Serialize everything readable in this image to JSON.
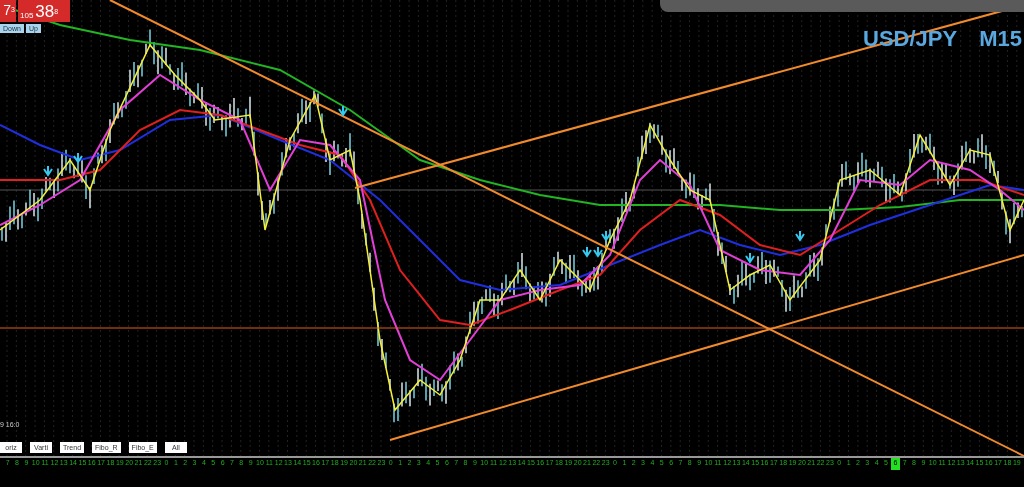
{
  "quote_panel": {
    "bid": {
      "main": "7",
      "sup": "3"
    },
    "ask": {
      "small": "105",
      "main": "38",
      "sup": "8"
    },
    "buttons": [
      "Down",
      "Up"
    ]
  },
  "symbol": "USD/JPY",
  "timeframe": "M15",
  "timestamp": "9 16:0",
  "tool_buttons": [
    "oriz",
    "Varti",
    "Trend",
    "Fibo_R",
    "Fibo_E",
    "All"
  ],
  "hour_labels": [
    {
      "label": "7",
      "selected": false
    },
    {
      "label": "8",
      "selected": false
    },
    {
      "label": "9",
      "selected": false
    },
    {
      "label": "10",
      "selected": false
    },
    {
      "label": "11",
      "selected": false
    },
    {
      "label": "12",
      "selected": false
    },
    {
      "label": "13",
      "selected": false
    },
    {
      "label": "14",
      "selected": false
    },
    {
      "label": "15",
      "selected": false
    },
    {
      "label": "16",
      "selected": false
    },
    {
      "label": "17",
      "selected": false
    },
    {
      "label": "18",
      "selected": false
    },
    {
      "label": "19",
      "selected": false
    },
    {
      "label": "20",
      "selected": false
    },
    {
      "label": "21",
      "selected": false
    },
    {
      "label": "22",
      "selected": false
    },
    {
      "label": "23",
      "selected": false
    },
    {
      "label": "0",
      "selected": false
    },
    {
      "label": "1",
      "selected": false
    },
    {
      "label": "2",
      "selected": false
    },
    {
      "label": "3",
      "selected": false
    },
    {
      "label": "4",
      "selected": false
    },
    {
      "label": "5",
      "selected": false
    },
    {
      "label": "6",
      "selected": false
    },
    {
      "label": "7",
      "selected": false
    },
    {
      "label": "8",
      "selected": false
    },
    {
      "label": "9",
      "selected": false
    },
    {
      "label": "10",
      "selected": false
    },
    {
      "label": "11",
      "selected": false
    },
    {
      "label": "12",
      "selected": false
    },
    {
      "label": "13",
      "selected": false
    },
    {
      "label": "14",
      "selected": false
    },
    {
      "label": "15",
      "selected": false
    },
    {
      "label": "16",
      "selected": false
    },
    {
      "label": "17",
      "selected": false
    },
    {
      "label": "18",
      "selected": false
    },
    {
      "label": "19",
      "selected": false
    },
    {
      "label": "20",
      "selected": false
    },
    {
      "label": "21",
      "selected": false
    },
    {
      "label": "22",
      "selected": false
    },
    {
      "label": "23",
      "selected": false
    },
    {
      "label": "0",
      "selected": false
    },
    {
      "label": "1",
      "selected": false
    },
    {
      "label": "2",
      "selected": false
    },
    {
      "label": "3",
      "selected": false
    },
    {
      "label": "4",
      "selected": false
    },
    {
      "label": "5",
      "selected": false
    },
    {
      "label": "6",
      "selected": false
    },
    {
      "label": "7",
      "selected": false
    },
    {
      "label": "8",
      "selected": false
    },
    {
      "label": "9",
      "selected": false
    },
    {
      "label": "10",
      "selected": false
    },
    {
      "label": "11",
      "selected": false
    },
    {
      "label": "12",
      "selected": false
    },
    {
      "label": "13",
      "selected": false
    },
    {
      "label": "14",
      "selected": false
    },
    {
      "label": "15",
      "selected": false
    },
    {
      "label": "16",
      "selected": false
    },
    {
      "label": "17",
      "selected": false
    },
    {
      "label": "18",
      "selected": false
    },
    {
      "label": "19",
      "selected": false
    },
    {
      "label": "20",
      "selected": false
    },
    {
      "label": "21",
      "selected": false
    },
    {
      "label": "22",
      "selected": false
    },
    {
      "label": "23",
      "selected": false
    },
    {
      "label": "0",
      "selected": false
    },
    {
      "label": "1",
      "selected": false
    },
    {
      "label": "2",
      "selected": false
    },
    {
      "label": "3",
      "selected": false
    },
    {
      "label": "4",
      "selected": false
    },
    {
      "label": "5",
      "selected": false
    },
    {
      "label": "6",
      "selected": false
    },
    {
      "label": "7",
      "selected": false
    },
    {
      "label": "8",
      "selected": false
    },
    {
      "label": "9",
      "selected": false
    },
    {
      "label": "10",
      "selected": false
    },
    {
      "label": "11",
      "selected": false
    },
    {
      "label": "12",
      "selected": false
    },
    {
      "label": "13",
      "selected": false
    },
    {
      "label": "14",
      "selected": false
    },
    {
      "label": "15",
      "selected": false
    },
    {
      "label": "16",
      "selected": false
    },
    {
      "label": "17",
      "selected": false
    },
    {
      "label": "18",
      "selected": false
    },
    {
      "label": "19",
      "selected": false
    },
    {
      "label": "20",
      "selected": false
    },
    {
      "label": "21",
      "selected": false
    },
    {
      "label": "22",
      "selected": false
    },
    {
      "label": "23",
      "selected": false
    },
    {
      "label": "0",
      "selected": false
    },
    {
      "label": "1",
      "selected": false
    },
    {
      "label": "2",
      "selected": false
    },
    {
      "label": "3",
      "selected": false
    },
    {
      "label": "4",
      "selected": false
    },
    {
      "label": "5",
      "selected": false
    },
    {
      "label": "6",
      "selected": true
    },
    {
      "label": "7",
      "selected": false
    },
    {
      "label": "8",
      "selected": false
    },
    {
      "label": "9",
      "selected": false
    },
    {
      "label": "10",
      "selected": false
    },
    {
      "label": "11",
      "selected": false
    },
    {
      "label": "12",
      "selected": false
    },
    {
      "label": "13",
      "selected": false
    },
    {
      "label": "14",
      "selected": false
    },
    {
      "label": "15",
      "selected": false
    },
    {
      "label": "16",
      "selected": false
    },
    {
      "label": "17",
      "selected": false
    },
    {
      "label": "18",
      "selected": false
    },
    {
      "label": "19",
      "selected": false
    }
  ]
}
